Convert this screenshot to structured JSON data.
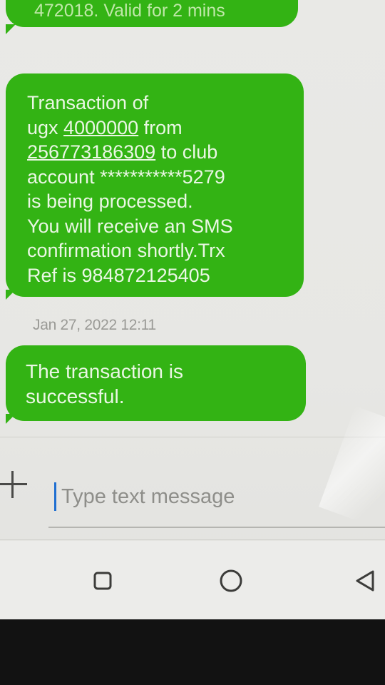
{
  "messages": {
    "top_partial": "472018. Valid for 2 mins",
    "transaction": {
      "line1": "Transaction of",
      "line2_prefix": "ugx ",
      "amount": "4000000",
      "line2_suffix": " from",
      "phone": "256773186309",
      "line3_suffix": " to club",
      "line4": "account ***********5279",
      "line5": "is being processed.",
      "line6": "You will receive an SMS",
      "line7": "confirmation shortly.Trx",
      "line8": "Ref is 984872125405"
    },
    "timestamp": "Jan 27, 2022  12:11",
    "success": {
      "line1": "The transaction is",
      "line2": "successful."
    }
  },
  "composer": {
    "placeholder": "Type text message",
    "attach_icon": "plus-icon"
  },
  "navigation": {
    "recent_icon": "square-icon",
    "home_icon": "circle-icon",
    "back_icon": "triangle-back-icon"
  },
  "colors": {
    "bubble": "#33b314",
    "bubble_text": "#eaf7e4",
    "cursor": "#1f6fd1",
    "bezel": "#121212"
  }
}
